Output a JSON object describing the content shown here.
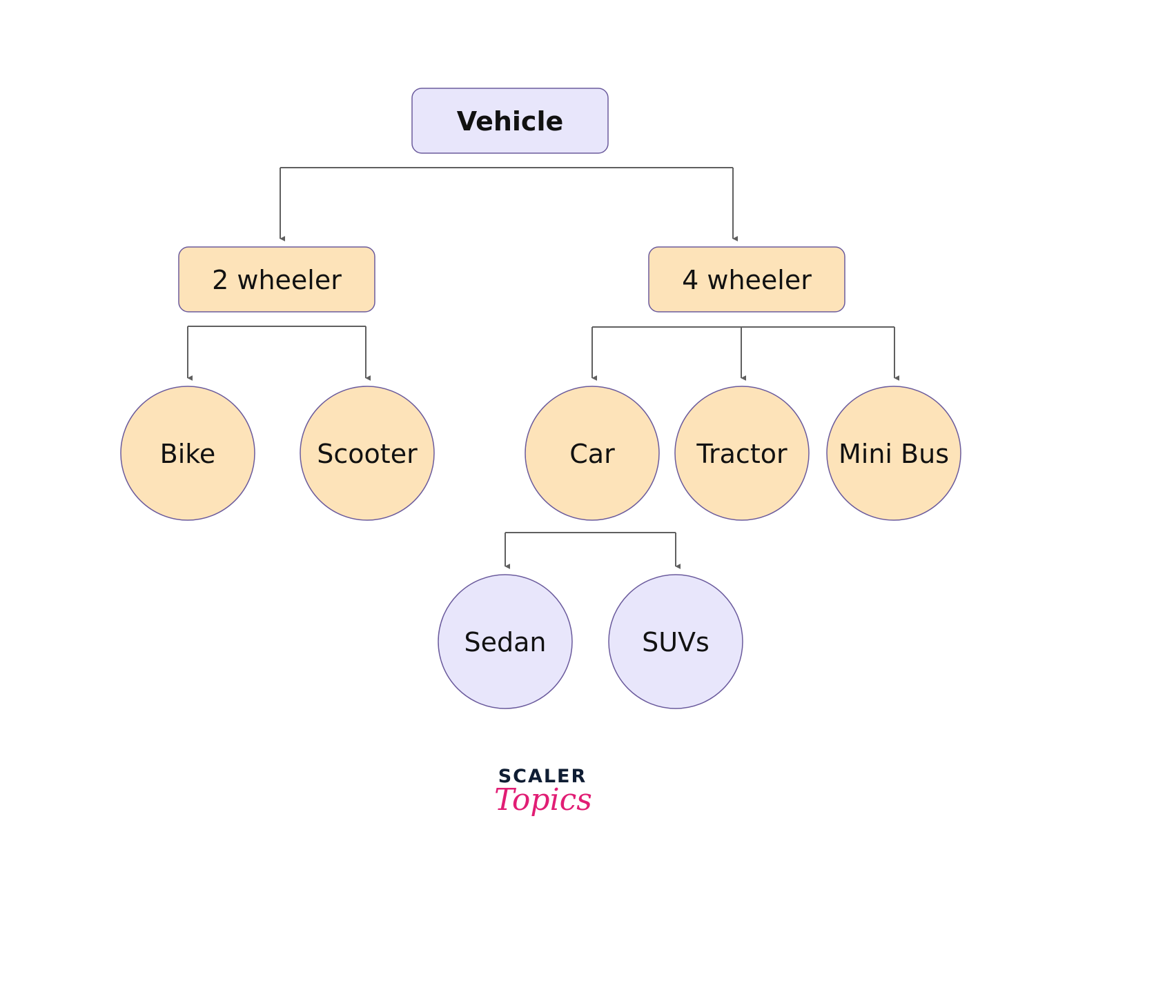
{
  "title": "Vehicle",
  "nodes": {
    "vehicle": {
      "label": "Vehicle",
      "shape": "rect",
      "fill": "#e8e6fb",
      "bold": true
    },
    "two_wheeler": {
      "label": "2 wheeler",
      "shape": "rect",
      "fill": "#fde3b9"
    },
    "four_wheeler": {
      "label": "4 wheeler",
      "shape": "rect",
      "fill": "#fde3b9"
    },
    "bike": {
      "label": "Bike",
      "shape": "circle",
      "fill": "#fde3b9"
    },
    "scooter": {
      "label": "Scooter",
      "shape": "circle",
      "fill": "#fde3b9"
    },
    "car": {
      "label": "Car",
      "shape": "circle",
      "fill": "#fde3b9"
    },
    "tractor": {
      "label": "Tractor",
      "shape": "circle",
      "fill": "#fde3b9"
    },
    "mini_bus": {
      "label": "Mini Bus",
      "shape": "circle",
      "fill": "#fde3b9"
    },
    "sedan": {
      "label": "Sedan",
      "shape": "circle",
      "fill": "#e8e6fb"
    },
    "suvs": {
      "label": "SUVs",
      "shape": "circle",
      "fill": "#e8e6fb"
    }
  },
  "edges": [
    {
      "from": "vehicle",
      "to": [
        "two_wheeler",
        "four_wheeler"
      ]
    },
    {
      "from": "two_wheeler",
      "to": [
        "bike",
        "scooter"
      ]
    },
    {
      "from": "four_wheeler",
      "to": [
        "car",
        "tractor",
        "mini_bus"
      ]
    },
    {
      "from": "car",
      "to": [
        "sedan",
        "suvs"
      ]
    }
  ],
  "colors": {
    "stroke": "#6a5a9c",
    "connector": "#5f5f5f",
    "text": "#111111"
  },
  "logo": {
    "top": "SCALER",
    "bottom": "Topics",
    "top_color": "#0f1d33",
    "bottom_color": "#e11d74"
  }
}
